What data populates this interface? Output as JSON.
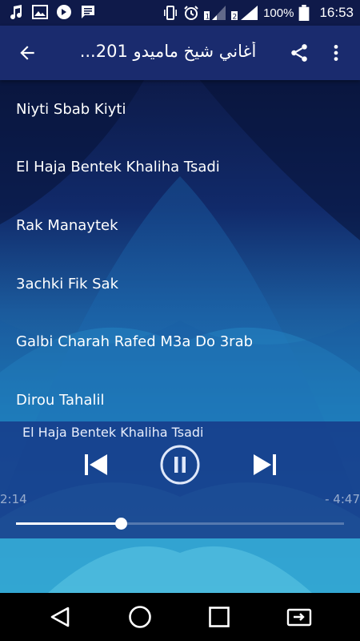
{
  "status_bar": {
    "left_icons": [
      "music-note-icon",
      "image-icon",
      "circle-badge-icon",
      "message-icon"
    ],
    "right_icons": [
      "phone-vibrate-icon",
      "alarm-icon",
      "signal-sim1-icon",
      "signal-sim2-icon",
      "battery-icon"
    ],
    "battery": "100%",
    "time": "16:53"
  },
  "app_bar": {
    "title": "أغاني شيخ ماميدو 201...",
    "back_icon": "arrow-back-icon",
    "share_icon": "share-icon",
    "menu_icon": "more-vert-icon"
  },
  "songs": [
    {
      "title": "Niyti Sbab Kiyti"
    },
    {
      "title": "El Haja Bentek Khaliha Tsadi"
    },
    {
      "title": "Rak Manaytek"
    },
    {
      "title": "3achki Fik Sak"
    },
    {
      "title": "Galbi Charah Rafed M3a Do 3rab"
    },
    {
      "title": "Dirou Tahalil"
    }
  ],
  "player": {
    "now_playing": "El Haja Bentek Khaliha Tsadi",
    "elapsed": "2:14",
    "remaining": "- 4:47",
    "progress_fraction": 0.32,
    "state": "playing"
  },
  "nav_bar": {
    "icons": [
      "back-triangle-icon",
      "home-circle-icon",
      "recents-square-icon",
      "screen-switch-icon"
    ]
  },
  "colors": {
    "status_bar": "#0f1a4a",
    "app_bar": "#1a2b6e",
    "player_panel": "#163484",
    "accent": "#ffffff"
  }
}
